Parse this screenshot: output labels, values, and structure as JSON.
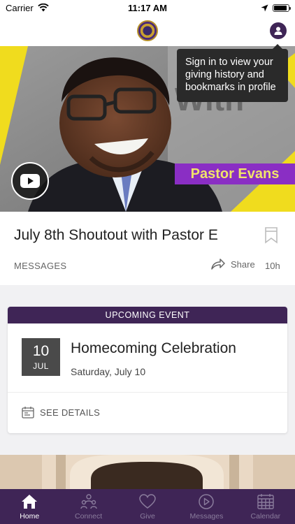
{
  "status_bar": {
    "carrier": "Carrier",
    "time": "11:17 AM",
    "battery_level": 0.92
  },
  "nav": {
    "logo_icon": "church-seal-logo",
    "profile_icon": "user-icon"
  },
  "hero": {
    "overlay_text": "Pastor Evans",
    "play_icon": "youtube-play-icon",
    "colors": {
      "accent_yellow": "#f0dc1e",
      "tag_purple": "#8a2ec4"
    }
  },
  "tooltip": {
    "text": "Sign in to view your giving history and bookmarks in profile"
  },
  "message": {
    "title": "July 8th Shoutout with Pastor E",
    "category": "MESSAGES",
    "share_label": "Share",
    "age": "10h"
  },
  "event": {
    "header": "UPCOMING EVENT",
    "day": "10",
    "month": "JUL",
    "title": "Homecoming Celebration",
    "date_text": "Saturday, July 10",
    "details_label": "SEE DETAILS"
  },
  "tabs": [
    {
      "label": "Home",
      "icon": "home-icon",
      "active": true
    },
    {
      "label": "Connect",
      "icon": "people-icon",
      "active": false
    },
    {
      "label": "Give",
      "icon": "heart-icon",
      "active": false
    },
    {
      "label": "Messages",
      "icon": "play-circle-icon",
      "active": false
    },
    {
      "label": "Calendar",
      "icon": "calendar-icon",
      "active": false
    }
  ],
  "colors": {
    "brand_purple": "#3f2556",
    "tab_inactive": "#8a7c9c"
  }
}
